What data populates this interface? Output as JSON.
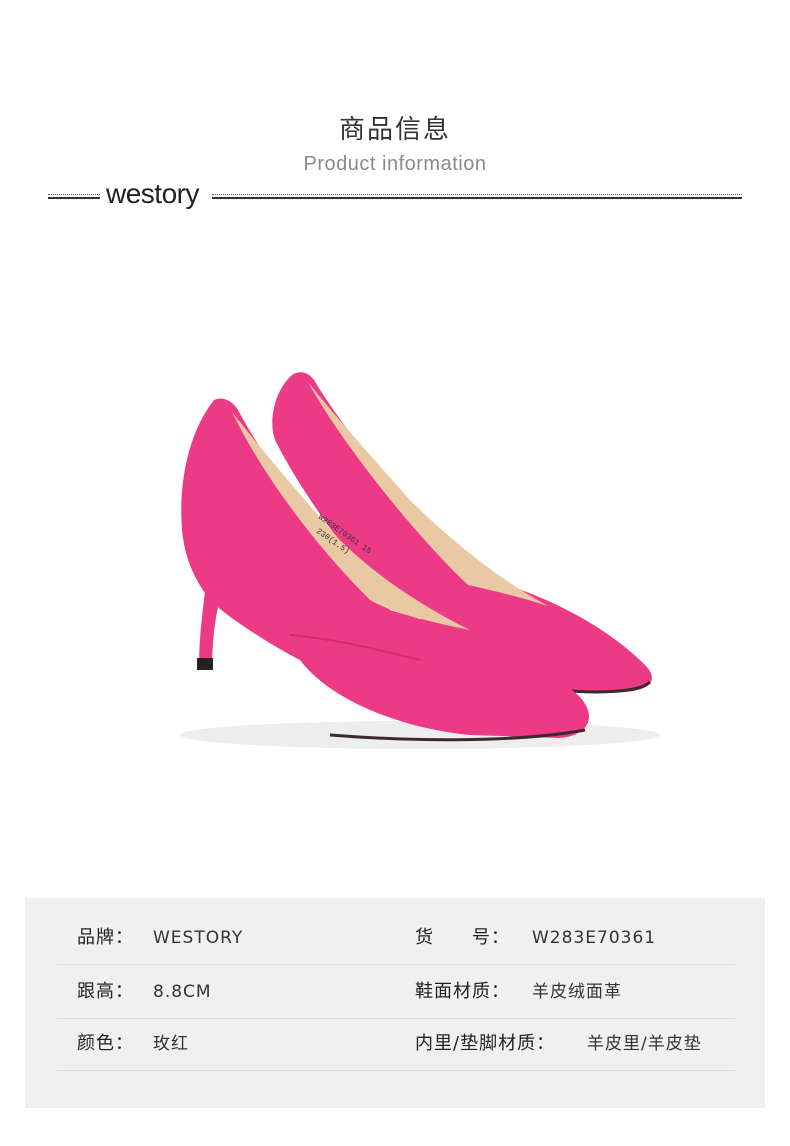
{
  "header": {
    "title_cn": "商品信息",
    "title_en": "Product information",
    "brand_logo": "westory"
  },
  "product": {
    "image_subject": "pink-pointed-toe-pumps",
    "insole_text_1": "W283E70361 15",
    "insole_text_2": "230(1.5)"
  },
  "colors": {
    "suede": "#ec3a86",
    "lining": "#e8c9a4",
    "panel_bg": "#f0f0f0"
  },
  "info": {
    "rows": [
      {
        "left_label": "品牌：",
        "left_value": "WESTORY",
        "right_label": "货　　号：",
        "right_value": "W283E70361"
      },
      {
        "left_label": "跟高：",
        "left_value": "8.8CM",
        "right_label": "鞋面材质：",
        "right_value": "羊皮绒面革"
      },
      {
        "left_label": "颜色：",
        "left_value": "玫红",
        "right_label": "内里/垫脚材质：",
        "right_value": "羊皮里/羊皮垫"
      }
    ]
  }
}
